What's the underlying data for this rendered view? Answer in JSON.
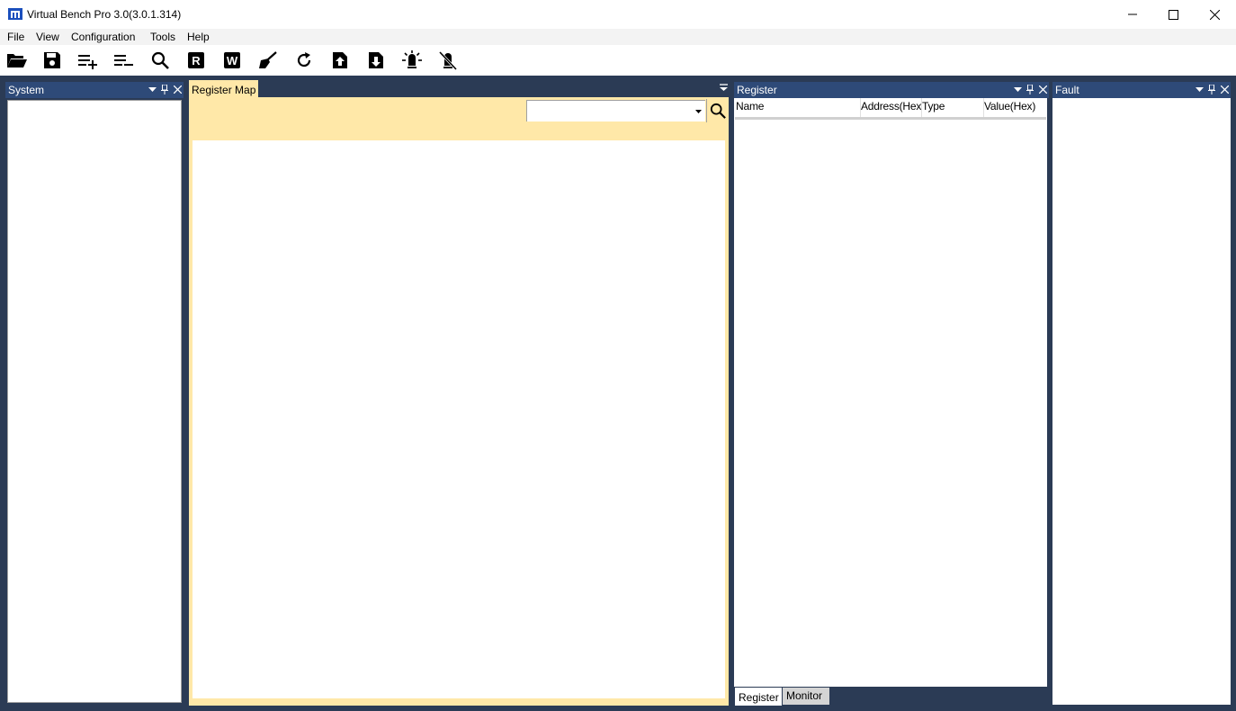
{
  "window": {
    "title": "Virtual Bench Pro 3.0(3.0.1.314)",
    "brand_color": "#1b4fbd"
  },
  "menu": [
    "File",
    "View",
    "Configuration",
    "Tools",
    "Help"
  ],
  "toolbar": [
    {
      "icon": "open-folder-icon"
    },
    {
      "icon": "save-icon"
    },
    {
      "icon": "add-list-icon"
    },
    {
      "icon": "remove-list-icon"
    },
    {
      "icon": "search-icon"
    },
    {
      "icon": "read-icon",
      "text": "R"
    },
    {
      "icon": "write-icon",
      "text": "W"
    },
    {
      "icon": "clear-brush-icon"
    },
    {
      "icon": "refresh-icon"
    },
    {
      "icon": "upload-icon"
    },
    {
      "icon": "download-icon"
    },
    {
      "icon": "led-on-icon"
    },
    {
      "icon": "led-off-icon"
    }
  ],
  "panels": {
    "system": {
      "title": "System"
    },
    "register_map": {
      "tab": "Register Map",
      "search_value": ""
    },
    "register": {
      "title": "Register",
      "columns": [
        "Name",
        "Address(Hex)",
        "Type",
        "Value(Hex)"
      ],
      "tabs": [
        "Register",
        "Monitor"
      ]
    },
    "fault": {
      "title": "Fault"
    }
  },
  "colors": {
    "dock_bg": "#2b3b55",
    "panel_header": "#2e4a78",
    "register_map_bg": "#ffe8a8"
  }
}
